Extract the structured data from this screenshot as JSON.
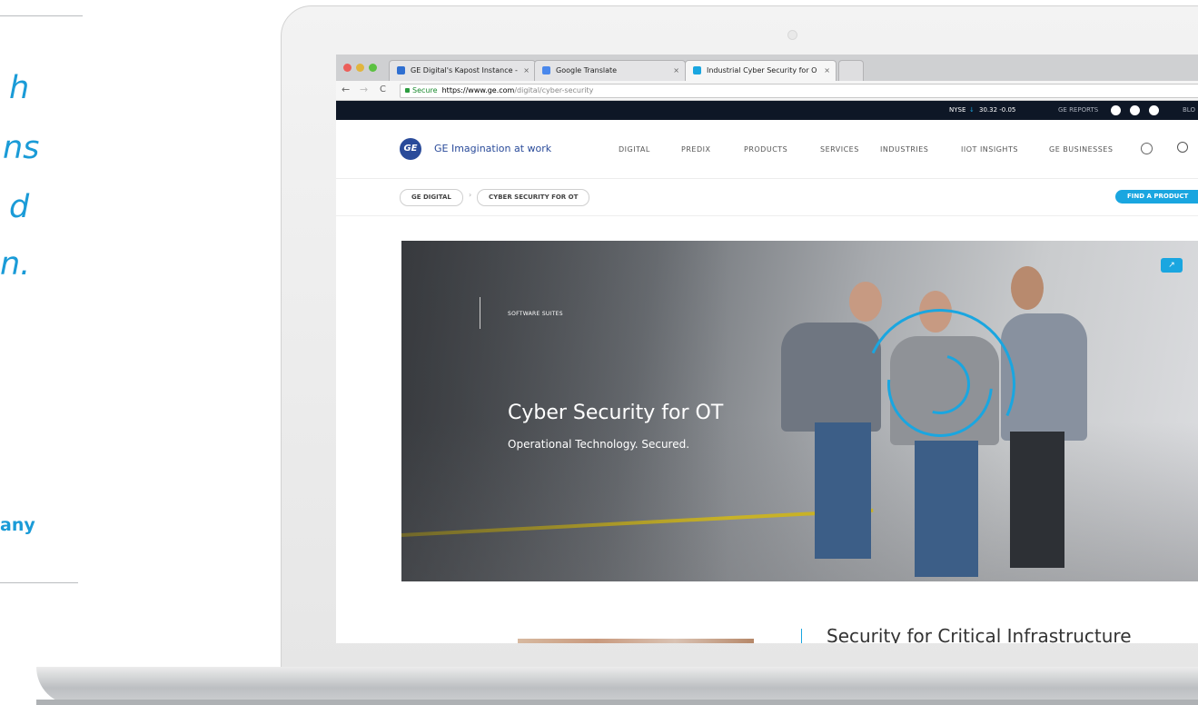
{
  "left_panel": {
    "quote_fragments": [
      "h",
      "ns",
      "d",
      "n."
    ],
    "company_fragment": "any"
  },
  "browser": {
    "tabs": [
      {
        "title": "GE Digital's Kapost Instance -",
        "close": "×",
        "icon_color": "#2f6fd1"
      },
      {
        "title": "Google Translate",
        "close": "×",
        "icon_color": "#4a88ec"
      },
      {
        "title": "Industrial Cyber Security for O",
        "close": "×",
        "icon_color": "#1aa6e0"
      }
    ],
    "nav": {
      "back": "←",
      "forward": "→",
      "reload": "C"
    },
    "address": {
      "secure_label": "Secure",
      "host": "https://www.ge.com",
      "path": "/digital/cyber-security"
    }
  },
  "site": {
    "topbar": {
      "stock": "NYSE",
      "stock_arrow": "↓",
      "stock_value": "30.32 -0.05",
      "reports": "GE REPORTS",
      "blog_fragment": "BLO"
    },
    "brand": {
      "logo_text": "GE",
      "name": "GE Imagination at work"
    },
    "nav_items": [
      "DIGITAL",
      "PREDIX",
      "PRODUCTS",
      "SERVICES",
      "INDUSTRIES",
      "IIOT INSIGHTS",
      "GE BUSINESSES"
    ],
    "breadcrumb": {
      "items": [
        "GE DIGITAL",
        "CYBER SECURITY FOR OT"
      ],
      "separator": "›"
    },
    "find_product_label": "FIND A PRODUCT",
    "hero": {
      "eyebrow": "SOFTWARE SUITES",
      "title": "Cyber Security for OT",
      "subtitle": "Operational Technology. Secured.",
      "external_icon": "↗"
    },
    "below_title_fragment": "Security for Critical Infrastructure"
  },
  "colors": {
    "accent": "#1a9bd7",
    "ge_blue": "#2a4b9a",
    "topbar_bg": "#0e1726",
    "cta": "#1aa6e0"
  }
}
